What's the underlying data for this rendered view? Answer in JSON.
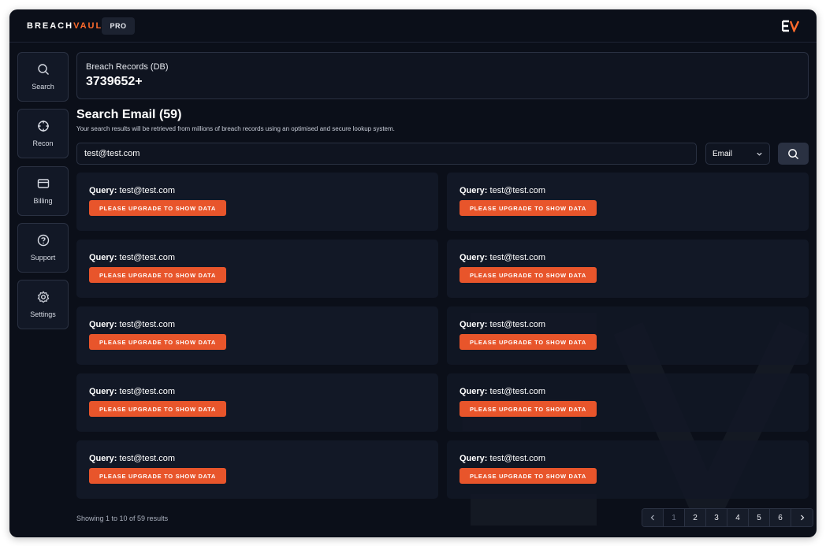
{
  "header": {
    "logo_main": "BREACH",
    "logo_accent": "VAULT",
    "plan_badge": "PRO",
    "brand_mark_icon": "ev-logo-icon"
  },
  "sidebar": {
    "items": [
      {
        "label": "Search",
        "icon": "search-icon"
      },
      {
        "label": "Recon",
        "icon": "crosshair-icon"
      },
      {
        "label": "Billing",
        "icon": "credit-card-icon"
      },
      {
        "label": "Support",
        "icon": "help-circle-icon"
      },
      {
        "label": "Settings",
        "icon": "gear-icon"
      }
    ]
  },
  "stats": {
    "label": "Breach Records (DB)",
    "value": "3739652+"
  },
  "search": {
    "title": "Search Email (59)",
    "subtitle": "Your search results will be retrieved from millions of breach records using an optimised and secure lookup system.",
    "query_value": "test@test.com",
    "type_selected": "Email"
  },
  "results": [
    {
      "query_label": "Query:",
      "query_value": "test@test.com",
      "button": "PLEASE UPGRADE TO SHOW DATA"
    },
    {
      "query_label": "Query:",
      "query_value": "test@test.com",
      "button": "PLEASE UPGRADE TO SHOW DATA"
    },
    {
      "query_label": "Query:",
      "query_value": "test@test.com",
      "button": "PLEASE UPGRADE TO SHOW DATA"
    },
    {
      "query_label": "Query:",
      "query_value": "test@test.com",
      "button": "PLEASE UPGRADE TO SHOW DATA"
    },
    {
      "query_label": "Query:",
      "query_value": "test@test.com",
      "button": "PLEASE UPGRADE TO SHOW DATA"
    },
    {
      "query_label": "Query:",
      "query_value": "test@test.com",
      "button": "PLEASE UPGRADE TO SHOW DATA"
    },
    {
      "query_label": "Query:",
      "query_value": "test@test.com",
      "button": "PLEASE UPGRADE TO SHOW DATA"
    },
    {
      "query_label": "Query:",
      "query_value": "test@test.com",
      "button": "PLEASE UPGRADE TO SHOW DATA"
    },
    {
      "query_label": "Query:",
      "query_value": "test@test.com",
      "button": "PLEASE UPGRADE TO SHOW DATA"
    },
    {
      "query_label": "Query:",
      "query_value": "test@test.com",
      "button": "PLEASE UPGRADE TO SHOW DATA"
    }
  ],
  "footer": {
    "showing": "Showing 1 to 10 of 59 results",
    "pages": [
      "1",
      "2",
      "3",
      "4",
      "5",
      "6"
    ],
    "current_page": "1"
  },
  "colors": {
    "background": "#0b0f19",
    "card": "#121826",
    "accent": "#e8552b",
    "brand_orange": "#ff6b2c"
  }
}
